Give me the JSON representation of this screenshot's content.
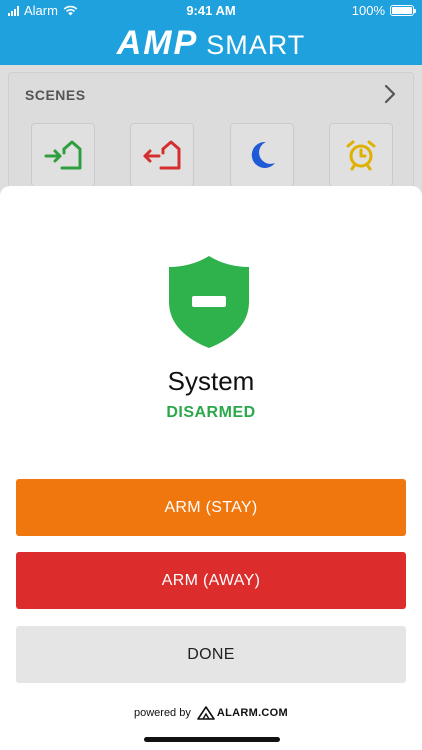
{
  "status_bar": {
    "carrier": "Alarm",
    "time": "9:41 AM",
    "battery_text": "100%",
    "battery_level": 1.0
  },
  "header": {
    "logo_main": "AMP",
    "logo_sub": "SMART"
  },
  "scenes": {
    "title": "SCENES",
    "items": [
      {
        "icon": "arrive-home-icon",
        "color": "#2e9e3e"
      },
      {
        "icon": "leave-home-icon",
        "color": "#d32f2f"
      },
      {
        "icon": "moon-icon",
        "color": "#1f5bd6"
      },
      {
        "icon": "alarm-clock-icon",
        "color": "#e0b000"
      }
    ]
  },
  "sheet": {
    "system_label": "System",
    "status_label": "DISARMED",
    "status_color": "#2aa84a",
    "buttons": {
      "arm_stay": "ARM (STAY)",
      "arm_away": "ARM (AWAY)",
      "done": "DONE"
    },
    "powered_by": "powered by",
    "brand": "ALARM.COM"
  },
  "colors": {
    "header": "#1ea1dc",
    "arm_stay": "#f0770e",
    "arm_away": "#dd2c2c",
    "done": "#e5e5e5"
  }
}
